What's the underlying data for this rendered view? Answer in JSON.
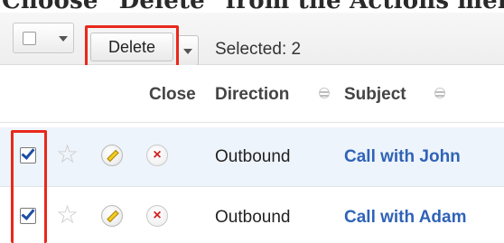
{
  "heading": "Choose \"Delete\" from the Actions menu",
  "toolbar": {
    "delete_label": "Delete",
    "selected_label": "Selected:",
    "selected_count": "2"
  },
  "columns": {
    "close": "Close",
    "direction": "Direction",
    "subject": "Subject"
  },
  "rows": [
    {
      "direction": "Outbound",
      "subject": "Call with John",
      "checked": true,
      "close_glyph": "×"
    },
    {
      "direction": "Outbound",
      "subject": "Call with Adam",
      "checked": true,
      "close_glyph": "×"
    }
  ],
  "icons": {
    "star": "☆"
  },
  "colors": {
    "highlight": "#e8281b",
    "link": "#2f63b7",
    "selected_row": "#eef4fb"
  }
}
